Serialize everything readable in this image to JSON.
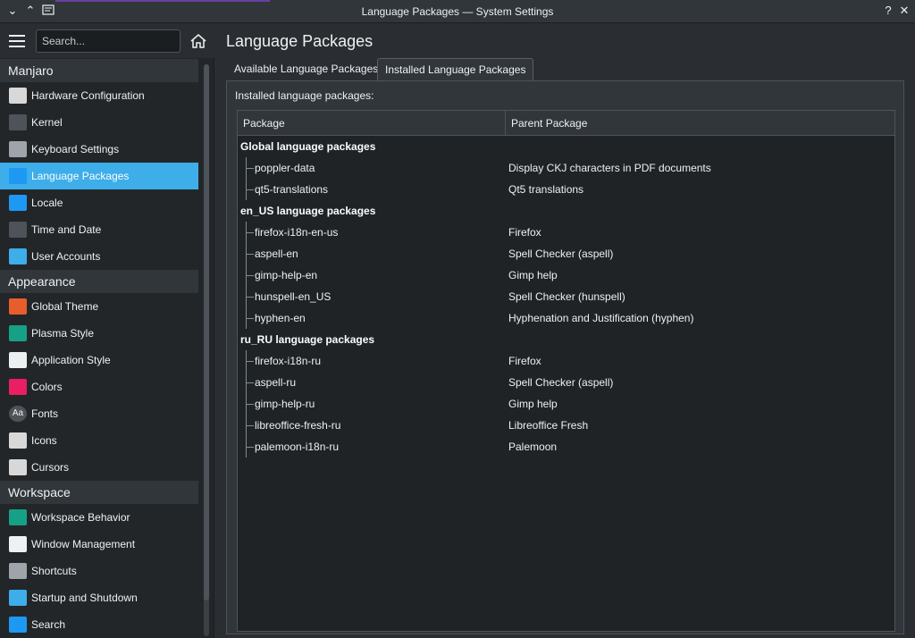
{
  "window": {
    "title": "Language Packages — System Settings",
    "help_glyph": "?",
    "close_glyph": "✕"
  },
  "sidebar": {
    "search_placeholder": "Search...",
    "categories": [
      {
        "name": "Manjaro",
        "items": [
          {
            "label": "Hardware Configuration",
            "icon": "hardware-icon",
            "color": "#d8d8d8"
          },
          {
            "label": "Kernel",
            "icon": "kernel-icon",
            "color": "#4d5358"
          },
          {
            "label": "Keyboard Settings",
            "icon": "keyboard-icon",
            "color": "#9ea4aa"
          },
          {
            "label": "Language Packages",
            "icon": "language-icon",
            "color": "#1d99f3",
            "active": true
          },
          {
            "label": "Locale",
            "icon": "locale-icon",
            "color": "#1d99f3"
          },
          {
            "label": "Time and Date",
            "icon": "clock-icon",
            "color": "#4d5358"
          },
          {
            "label": "User Accounts",
            "icon": "user-icon",
            "color": "#3daee9"
          }
        ]
      },
      {
        "name": "Appearance",
        "items": [
          {
            "label": "Global Theme",
            "icon": "global-theme-icon",
            "color": "#e85d2c"
          },
          {
            "label": "Plasma Style",
            "icon": "plasma-style-icon",
            "color": "#16a085"
          },
          {
            "label": "Application Style",
            "icon": "application-style-icon",
            "color": "#ecf0f1"
          },
          {
            "label": "Colors",
            "icon": "colors-icon",
            "color": "#e91e63"
          },
          {
            "label": "Fonts",
            "icon": "fonts-icon",
            "color": "#4d5358",
            "glyph": "Aa"
          },
          {
            "label": "Icons",
            "icon": "icons-icon",
            "color": "#d8d8d8"
          },
          {
            "label": "Cursors",
            "icon": "cursors-icon",
            "color": "#d8d8d8"
          }
        ]
      },
      {
        "name": "Workspace",
        "items": [
          {
            "label": "Workspace Behavior",
            "icon": "workspace-behavior-icon",
            "color": "#16a085"
          },
          {
            "label": "Window Management",
            "icon": "window-management-icon",
            "color": "#eff0f1"
          },
          {
            "label": "Shortcuts",
            "icon": "shortcuts-icon",
            "color": "#9ea4aa"
          },
          {
            "label": "Startup and Shutdown",
            "icon": "startup-icon",
            "color": "#3daee9"
          },
          {
            "label": "Search",
            "icon": "search-icon",
            "color": "#1d99f3"
          }
        ]
      }
    ]
  },
  "main": {
    "page_title": "Language Packages",
    "tabs": [
      {
        "label": "Available Language Packages"
      },
      {
        "label": "Installed Language Packages",
        "active": true
      }
    ],
    "panel_label": "Installed language packages:",
    "table": {
      "columns": [
        "Package",
        "Parent Package"
      ],
      "groups": [
        {
          "name": "Global language packages",
          "rows": [
            {
              "package": "poppler-data",
              "parent": "Display CKJ characters in PDF documents"
            },
            {
              "package": "qt5-translations",
              "parent": "Qt5 translations"
            }
          ]
        },
        {
          "name": "en_US language packages",
          "rows": [
            {
              "package": "firefox-i18n-en-us",
              "parent": "Firefox"
            },
            {
              "package": "aspell-en",
              "parent": "Spell Checker (aspell)"
            },
            {
              "package": "gimp-help-en",
              "parent": "Gimp help"
            },
            {
              "package": "hunspell-en_US",
              "parent": "Spell Checker (hunspell)"
            },
            {
              "package": "hyphen-en",
              "parent": "Hyphenation and Justification (hyphen)"
            }
          ]
        },
        {
          "name": "ru_RU language packages",
          "rows": [
            {
              "package": "firefox-i18n-ru",
              "parent": "Firefox"
            },
            {
              "package": "aspell-ru",
              "parent": "Spell Checker (aspell)"
            },
            {
              "package": "gimp-help-ru",
              "parent": "Gimp help"
            },
            {
              "package": "libreoffice-fresh-ru",
              "parent": "Libreoffice Fresh"
            },
            {
              "package": "palemoon-i18n-ru",
              "parent": "Palemoon"
            }
          ]
        }
      ]
    }
  }
}
